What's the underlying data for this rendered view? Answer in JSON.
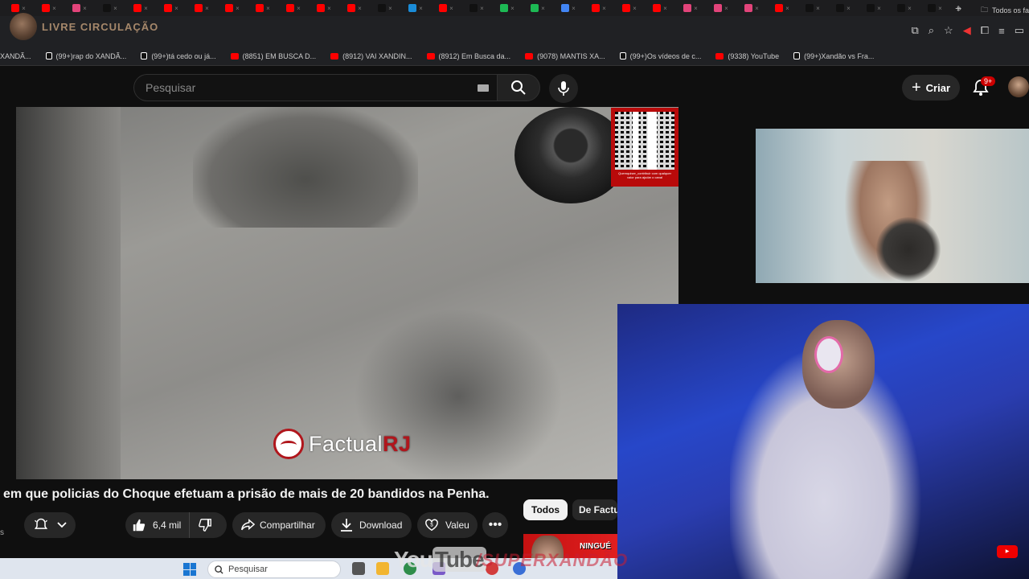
{
  "browser": {
    "tabs": [
      "",
      "",
      "",
      "",
      "",
      "",
      "",
      "",
      "",
      "",
      "",
      "",
      "",
      "",
      "",
      "",
      "",
      "",
      "",
      "",
      "",
      "",
      "",
      "",
      "",
      "",
      "",
      "",
      "",
      ""
    ],
    "tab_colors": [
      "#f00",
      "#f00",
      "#e2447a",
      "#111",
      "#f00",
      "#f00",
      "#f00",
      "#f00",
      "#f00",
      "#f00",
      "#f00",
      "#f00",
      "#111",
      "#1a8cd8",
      "#f00",
      "#111",
      "#1db954",
      "#1db954",
      "#4285f4",
      "#f00",
      "#f00",
      "#f00",
      "#e2447a",
      "#e2447a",
      "#e2447a",
      "#f00",
      "#111",
      "#111",
      "#111",
      "#111",
      "#111"
    ],
    "watermark_text": "LIVRE CIRCULAÇÃO",
    "bookmarks": [
      {
        "label": "XANDÃ...",
        "type": "none"
      },
      {
        "label": "(99+)rap do XANDÃ...",
        "type": "tiktok"
      },
      {
        "label": "(99+)tá cedo ou já...",
        "type": "tiktok"
      },
      {
        "label": "(8851) EM BUSCA D...",
        "type": "youtube"
      },
      {
        "label": "(8912) VAI XANDIN...",
        "type": "youtube"
      },
      {
        "label": "(8912) Em Busca da...",
        "type": "youtube"
      },
      {
        "label": "(9078) MANTIS   XA...",
        "type": "youtube"
      },
      {
        "label": "(99+)Os vídeos de c...",
        "type": "tiktok"
      },
      {
        "label": "(9338) YouTube",
        "type": "youtube"
      },
      {
        "label": "(99+)Xandão vs Fra...",
        "type": "tiktok"
      }
    ],
    "bookmarks_more": "»",
    "bookmarks_folder": "Todos os fa"
  },
  "youtube": {
    "search_placeholder": "Pesquisar",
    "create_label": "Criar",
    "notif_badge": "9+",
    "video_title": "em que policias do Choque efetuam a prisão de mais de 20 bandidos na Penha.",
    "like_count": "6,4 mil",
    "share_label": "Compartilhar",
    "download_label": "Download",
    "thanks_label": "Valeu",
    "chips": [
      "Todos",
      "De Factual"
    ],
    "thumb_word": "NINGUÉ"
  },
  "video": {
    "logo_text_1": "Factual",
    "logo_text_2": "RJ",
    "qr_caption": "Quemquiser_contribuir com qualquer valor para ajudar o canal"
  },
  "taskbar": {
    "search_placeholder": "Pesquisar"
  },
  "overlay": {
    "yt_you": "You",
    "yt_tube": "Tube",
    "channel": "/SUPERXANDÃO"
  },
  "colors": {
    "youtube_bg": "#0f0f0f",
    "accent_red": "#cc0000",
    "factual_red": "#b0161c"
  }
}
